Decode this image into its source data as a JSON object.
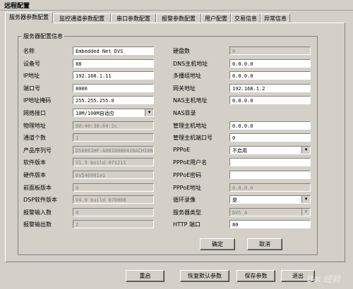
{
  "window": {
    "title": "远程配置"
  },
  "tabs": [
    "服务器参数配置",
    "监控通道参数配置",
    "串口参数配置",
    "报警参数配置",
    "用户配置",
    "交易信息",
    "异常信息"
  ],
  "group_title": "服务器配置信息",
  "left": [
    {
      "label": "名称",
      "value": "Embedded Net DVS",
      "type": "input"
    },
    {
      "label": "设备号",
      "value": "88",
      "type": "input"
    },
    {
      "label": "IP地址",
      "value": "192.168.1.11",
      "type": "input"
    },
    {
      "label": "端口号",
      "value": "8000",
      "type": "input"
    },
    {
      "label": "IP地址掩码",
      "value": "255.255.255.0",
      "type": "input"
    },
    {
      "label": "网络接口",
      "value": "10M/100M自适应",
      "type": "select"
    },
    {
      "label": "物理地址",
      "value": "00:40:36:84:2c",
      "type": "ro"
    },
    {
      "label": "通道个数",
      "value": "1",
      "type": "ro"
    },
    {
      "label": "产品序列号",
      "value": "DS6001HF-A0020080416ACH100",
      "type": "ro"
    },
    {
      "label": "软件版本",
      "value": "V1.5 build 071211",
      "type": "ro"
    },
    {
      "label": "硬件版本",
      "value": "0x540001a1",
      "type": "ro"
    },
    {
      "label": "前面板版本",
      "value": "0",
      "type": "ro"
    },
    {
      "label": "DSP软件版本",
      "value": "V4.0 build 070808",
      "type": "ro"
    },
    {
      "label": "报警输入数",
      "value": "4",
      "type": "ro"
    },
    {
      "label": "报警输出数",
      "value": "2",
      "type": "ro"
    }
  ],
  "right": [
    {
      "label": "硬盘数",
      "value": "0",
      "type": "ro"
    },
    {
      "label": "DNS主机地址",
      "value": "0.0.0.0",
      "type": "input"
    },
    {
      "label": "多播组地址",
      "value": "0.0.0.0",
      "type": "input"
    },
    {
      "label": "网关地址",
      "value": "192.168.1.2",
      "type": "input"
    },
    {
      "label": "NAS主机地址",
      "value": "0.0.0.0",
      "type": "input"
    },
    {
      "label": "NAS目录",
      "value": "",
      "type": "none"
    },
    {
      "label": "管理主机地址",
      "value": "0.0.0.0",
      "type": "input"
    },
    {
      "label": "管理主机端口号",
      "value": "0",
      "type": "input"
    },
    {
      "label": "PPPoE",
      "value": "不启用",
      "type": "select"
    },
    {
      "label": "PPPoE用户名",
      "value": "",
      "type": "input"
    },
    {
      "label": "PPPoE密码",
      "value": "",
      "type": "input"
    },
    {
      "label": "PPPoE地址",
      "value": "0.0.0.0",
      "type": "ro"
    },
    {
      "label": "循环录像",
      "value": "是",
      "type": "select"
    },
    {
      "label": "服务器类型",
      "value": "DVS_A",
      "type": "rosel"
    },
    {
      "label": "HTTP 端口",
      "value": "80",
      "type": "input"
    }
  ],
  "buttons": {
    "ok": "确定",
    "cancel": "取消",
    "reboot": "重启",
    "restore": "恢复默认参数",
    "save": "保存参数",
    "exit": "退出"
  },
  "watermark": "Bai 经验"
}
